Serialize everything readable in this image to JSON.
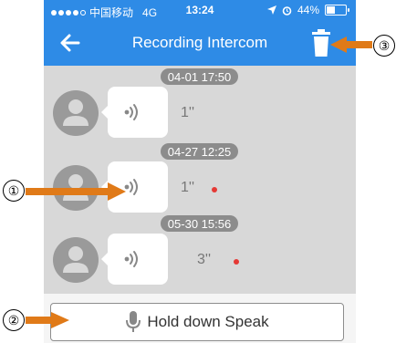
{
  "status_bar": {
    "carrier": "中国移动",
    "network": "4G",
    "time": "13:24",
    "battery": "44%",
    "battery_level": 0.44
  },
  "nav": {
    "title": "Recording Intercom",
    "back_icon": "arrow-left-icon",
    "delete_icon": "trash-icon"
  },
  "messages": [
    {
      "timestamp": "04-01 17:50",
      "duration": "1''",
      "unread": false
    },
    {
      "timestamp": "04-27 12:25",
      "duration": "1''",
      "unread": true
    },
    {
      "timestamp": "05-30 15:56",
      "duration": "3''",
      "unread": true
    }
  ],
  "bottom": {
    "speak_label": "Hold down Speak",
    "mic_icon": "microphone-icon"
  },
  "callouts": {
    "one": "①",
    "two": "②",
    "three": "③"
  },
  "colors": {
    "accent": "#2e8be6",
    "callout_arrow": "#e07a18",
    "unread_dot": "#e53935"
  }
}
